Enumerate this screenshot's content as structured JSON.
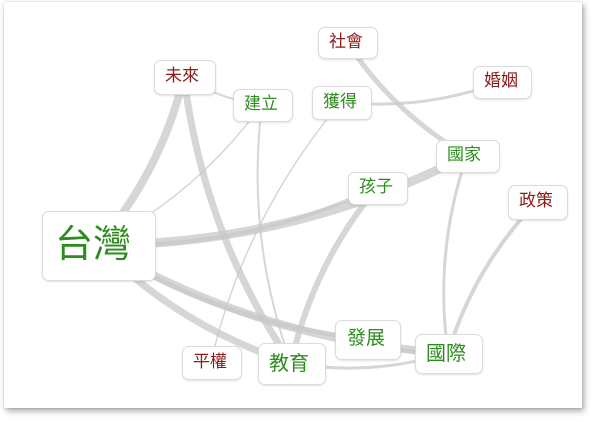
{
  "colors": {
    "green": "#2e8b1f",
    "red": "#8b1a1a",
    "edge": "#c8c8c8"
  },
  "nodes": {
    "taiwan": {
      "label": "台灣",
      "color": "green"
    },
    "future": {
      "label": "未來",
      "color": "red"
    },
    "society": {
      "label": "社會",
      "color": "red"
    },
    "marriage": {
      "label": "婚姻",
      "color": "red"
    },
    "build": {
      "label": "建立",
      "color": "green"
    },
    "obtain": {
      "label": "獲得",
      "color": "green"
    },
    "nation": {
      "label": "國家",
      "color": "green"
    },
    "child": {
      "label": "孩子",
      "color": "green"
    },
    "policy": {
      "label": "政策",
      "color": "red"
    },
    "develop": {
      "label": "發展",
      "color": "green"
    },
    "intl": {
      "label": "國際",
      "color": "green"
    },
    "equal": {
      "label": "平權",
      "color": "red"
    },
    "edu": {
      "label": "教育",
      "color": "green"
    }
  },
  "edges": [
    {
      "from": "taiwan",
      "to": "nation",
      "weight": 9
    },
    {
      "from": "taiwan",
      "to": "future",
      "weight": 8
    },
    {
      "from": "taiwan",
      "to": "edu",
      "weight": 7
    },
    {
      "from": "taiwan",
      "to": "intl",
      "weight": 8
    },
    {
      "from": "taiwan",
      "to": "develop",
      "weight": 5
    },
    {
      "from": "taiwan",
      "to": "child",
      "weight": 4
    },
    {
      "from": "taiwan",
      "to": "build",
      "weight": 1.5
    },
    {
      "from": "future",
      "to": "edu",
      "weight": 7
    },
    {
      "from": "future",
      "to": "build",
      "weight": 2
    },
    {
      "from": "child",
      "to": "edu",
      "weight": 6
    },
    {
      "from": "build",
      "to": "edu",
      "weight": 2
    },
    {
      "from": "obtain",
      "to": "equal",
      "weight": 1.5
    },
    {
      "from": "obtain",
      "to": "marriage",
      "weight": 3
    },
    {
      "from": "society",
      "to": "nation",
      "weight": 5
    },
    {
      "from": "nation",
      "to": "intl",
      "weight": 3
    },
    {
      "from": "policy",
      "to": "intl",
      "weight": 4
    },
    {
      "from": "develop",
      "to": "intl",
      "weight": 4
    },
    {
      "from": "edu",
      "to": "intl",
      "weight": 3
    }
  ]
}
